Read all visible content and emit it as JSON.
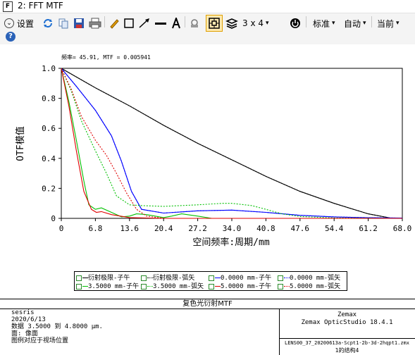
{
  "window": {
    "icon_letter": "F",
    "title": "2: FFT MTF"
  },
  "toolbar": {
    "settings_label": "设置",
    "layout_label": "3 x 4",
    "standard_label": "标准",
    "auto_label": "自动",
    "current_label": "当前",
    "help_label": "?"
  },
  "colors": {
    "black": "#000000",
    "blue": "#0000ff",
    "green": "#00c000",
    "red": "#e00000"
  },
  "chart_data": {
    "type": "line",
    "annotation": "频率= 45.91, MTF = 0.005941",
    "xlabel": "空间频率:周期/mm",
    "ylabel": "OTF模值",
    "xlim": [
      0,
      68
    ],
    "ylim": [
      0,
      1
    ],
    "x_ticks": [
      "0",
      "6.8",
      "13.6",
      "20.4",
      "27.2",
      "34.0",
      "40.8",
      "47.6",
      "54.4",
      "61.2",
      "68.0"
    ],
    "y_ticks": [
      "0",
      "0.2",
      "0.4",
      "0.6",
      "0.8",
      "1.0"
    ],
    "series": [
      {
        "name": "衍射极限-子午",
        "color": "#000000",
        "dash": false,
        "points": [
          [
            0,
            1.0
          ],
          [
            6.8,
            0.87
          ],
          [
            13.6,
            0.75
          ],
          [
            20.4,
            0.62
          ],
          [
            27.2,
            0.5
          ],
          [
            34.0,
            0.39
          ],
          [
            40.8,
            0.28
          ],
          [
            47.6,
            0.18
          ],
          [
            54.4,
            0.1
          ],
          [
            61.2,
            0.03
          ],
          [
            66.0,
            0.0
          ]
        ]
      },
      {
        "name": "衍射极限-弧矢",
        "color": "#000000",
        "dash": true,
        "points": [
          [
            0,
            1.0
          ],
          [
            6.8,
            0.87
          ],
          [
            13.6,
            0.75
          ],
          [
            20.4,
            0.62
          ],
          [
            27.2,
            0.5
          ],
          [
            34.0,
            0.39
          ],
          [
            40.8,
            0.28
          ],
          [
            47.6,
            0.18
          ],
          [
            54.4,
            0.1
          ],
          [
            61.2,
            0.03
          ],
          [
            66.0,
            0.0
          ]
        ]
      },
      {
        "name": "0.0000 mm-子午",
        "color": "#0000ff",
        "dash": false,
        "points": [
          [
            0,
            1.0
          ],
          [
            3,
            0.88
          ],
          [
            6.8,
            0.72
          ],
          [
            10,
            0.55
          ],
          [
            12,
            0.38
          ],
          [
            14,
            0.18
          ],
          [
            16,
            0.06
          ],
          [
            20.4,
            0.035
          ],
          [
            27.2,
            0.05
          ],
          [
            34.0,
            0.055
          ],
          [
            40.8,
            0.04
          ],
          [
            47.6,
            0.02
          ],
          [
            54.4,
            0.01
          ],
          [
            61.2,
            0.004
          ],
          [
            68,
            0.002
          ]
        ]
      },
      {
        "name": "0.0000 mm-弧矢",
        "color": "#0000ff",
        "dash": true,
        "points": [
          [
            0,
            1.0
          ],
          [
            3,
            0.88
          ],
          [
            6.8,
            0.72
          ],
          [
            10,
            0.55
          ],
          [
            12,
            0.38
          ],
          [
            14,
            0.18
          ],
          [
            16,
            0.06
          ],
          [
            20.4,
            0.035
          ],
          [
            27.2,
            0.05
          ],
          [
            34.0,
            0.055
          ],
          [
            40.8,
            0.04
          ],
          [
            47.6,
            0.02
          ],
          [
            54.4,
            0.01
          ],
          [
            61.2,
            0.004
          ],
          [
            68,
            0.002
          ]
        ]
      },
      {
        "name": "3.5000 mm-子午",
        "color": "#00c000",
        "dash": false,
        "points": [
          [
            0,
            1.0
          ],
          [
            1.5,
            0.78
          ],
          [
            3,
            0.52
          ],
          [
            4.5,
            0.25
          ],
          [
            5.5,
            0.09
          ],
          [
            6.8,
            0.06
          ],
          [
            8,
            0.07
          ],
          [
            10,
            0.04
          ],
          [
            12,
            0.01
          ],
          [
            13.6,
            0.015
          ],
          [
            15,
            0.03
          ],
          [
            17,
            0.025
          ],
          [
            20.4,
            0.005
          ],
          [
            22,
            0.015
          ],
          [
            24,
            0.03
          ],
          [
            27.2,
            0.015
          ],
          [
            30,
            0.0
          ],
          [
            34,
            0.0
          ],
          [
            68,
            0.0
          ]
        ]
      },
      {
        "name": "3.5000 mm-弧矢",
        "color": "#00c000",
        "dash": true,
        "points": [
          [
            0,
            1.0
          ],
          [
            2,
            0.85
          ],
          [
            4,
            0.65
          ],
          [
            6.8,
            0.45
          ],
          [
            9,
            0.3
          ],
          [
            11,
            0.15
          ],
          [
            13.6,
            0.09
          ],
          [
            16,
            0.085
          ],
          [
            20.4,
            0.08
          ],
          [
            27.2,
            0.09
          ],
          [
            32,
            0.1
          ],
          [
            34.0,
            0.1
          ],
          [
            38,
            0.085
          ],
          [
            40.8,
            0.06
          ],
          [
            44,
            0.03
          ],
          [
            47.6,
            0.012
          ],
          [
            54.4,
            0.003
          ],
          [
            68,
            0.0
          ]
        ]
      },
      {
        "name": "5.0000 mm-子午",
        "color": "#e00000",
        "dash": false,
        "points": [
          [
            0,
            1.0
          ],
          [
            1.5,
            0.75
          ],
          [
            3,
            0.45
          ],
          [
            4.5,
            0.18
          ],
          [
            6,
            0.06
          ],
          [
            7,
            0.04
          ],
          [
            8,
            0.045
          ],
          [
            10,
            0.025
          ],
          [
            13.6,
            0.005
          ],
          [
            20.4,
            0.0
          ],
          [
            68,
            0.0
          ]
        ]
      },
      {
        "name": "5.0000 mm-弧矢",
        "color": "#e00000",
        "dash": true,
        "points": [
          [
            0,
            1.0
          ],
          [
            2,
            0.86
          ],
          [
            4,
            0.68
          ],
          [
            6.8,
            0.52
          ],
          [
            9,
            0.42
          ],
          [
            11,
            0.3
          ],
          [
            13,
            0.17
          ],
          [
            15,
            0.06
          ],
          [
            17,
            0.015
          ],
          [
            20.4,
            0.0
          ],
          [
            68,
            0.0
          ]
        ]
      }
    ]
  },
  "legend": [
    {
      "label": "衍射极限-子午",
      "color": "#000000",
      "dash": false
    },
    {
      "label": "衍射极限-弧矢",
      "color": "#000000",
      "dash": true
    },
    {
      "label": "0.0000 mm-子午",
      "color": "#0000ff",
      "dash": false
    },
    {
      "label": "0.0000 mm-弧矢",
      "color": "#0000ff",
      "dash": true
    },
    {
      "label": "3.5000 mm-子午",
      "color": "#00c000",
      "dash": false
    },
    {
      "label": "3.5000 mm-弧矢",
      "color": "#00c000",
      "dash": true
    },
    {
      "label": "5.0000 mm-子午",
      "color": "#e00000",
      "dash": false
    },
    {
      "label": "5.0000 mm-弧矢",
      "color": "#e00000",
      "dash": true
    }
  ],
  "info": {
    "title": "复色光衍射MTF",
    "left_lines": [
      "sesris",
      "2020/6/13",
      "数据 3.5000 到 4.8000 μm.",
      "面: 像面",
      "图例对应于视场位置"
    ],
    "company": "Zemax",
    "product": "Zemax OpticStudio 18.4.1",
    "file": "LENS00_37_20200613a-Scpt1-2b-3d-2hqpt1.zmx",
    "config": "1的结构4"
  }
}
